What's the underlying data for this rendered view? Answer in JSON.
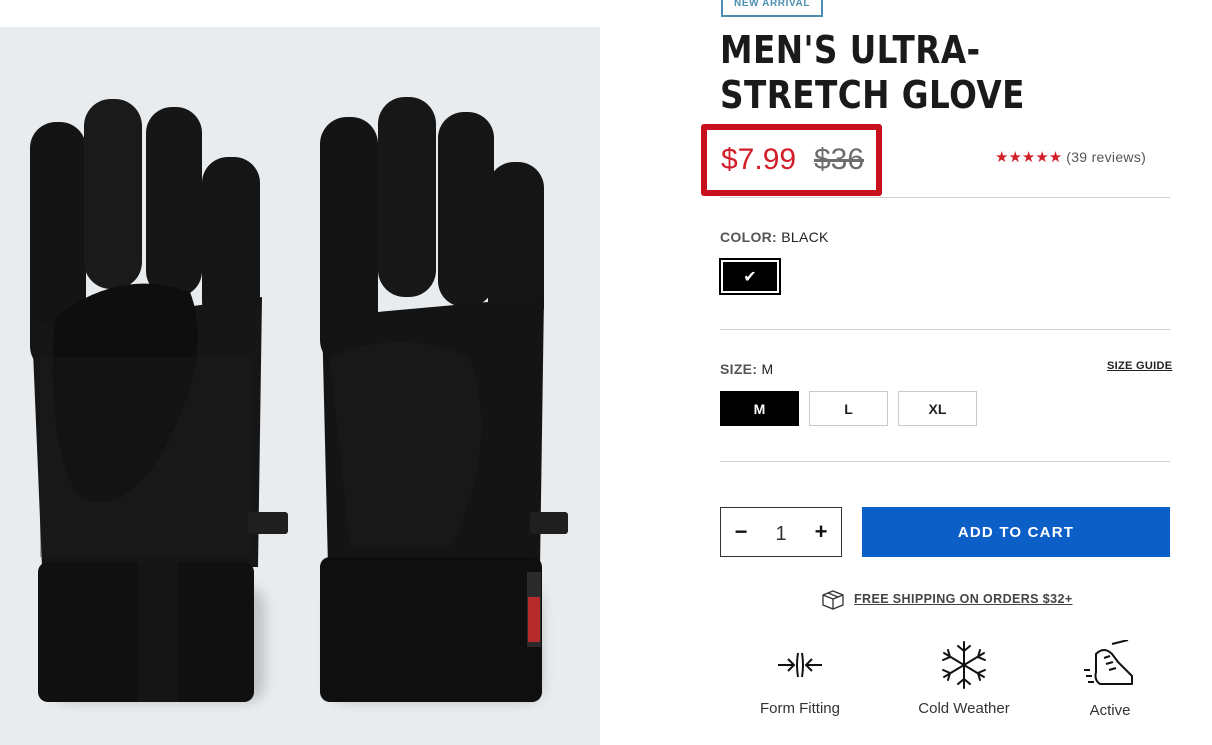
{
  "product": {
    "badge": "NEW ARRIVAL",
    "title": "MEN'S ULTRA-STRETCH GLOVE",
    "price_sale": "$7.99",
    "price_original": "$36",
    "rating": {
      "stars": "★★★★★",
      "reviews": "(39 reviews)",
      "value": 5
    },
    "color": {
      "label": "COLOR:",
      "value": "BLACK",
      "check_icon": "✔"
    },
    "size": {
      "label": "SIZE:",
      "value": "M",
      "guide": "SIZE GUIDE",
      "options": [
        "M",
        "L",
        "XL"
      ],
      "selected": "M"
    },
    "quantity": {
      "minus": "−",
      "value": "1",
      "plus": "+"
    },
    "add_to_cart": "ADD TO CART",
    "shipping": "FREE SHIPPING ON ORDERS $32+",
    "features": [
      {
        "label": "Form Fitting",
        "icon": "compress-arrows-icon"
      },
      {
        "label": "Cold Weather",
        "icon": "snowflake-icon"
      },
      {
        "label": "Active",
        "icon": "running-shoe-icon"
      }
    ]
  },
  "colors": {
    "accent_red": "#d21f2a",
    "cta_blue": "#0d5fc8",
    "badge_blue": "#4b8fb0"
  }
}
